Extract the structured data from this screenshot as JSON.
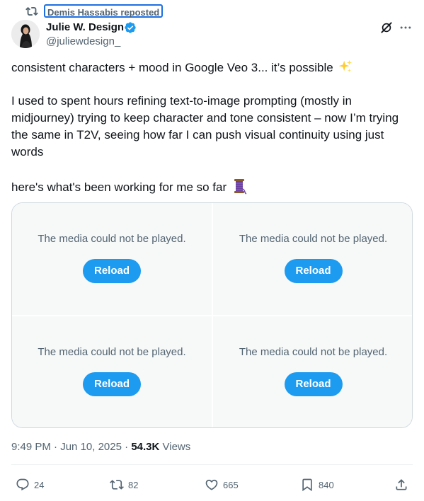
{
  "repost": {
    "label": "Demis Hassabis reposted",
    "icon": "repost-icon"
  },
  "author": {
    "name": "Julie W. Design",
    "handle": "@juliewdesign_",
    "verified": true
  },
  "post": {
    "line1": "consistent characters + mood in Google Veo 3... it’s possible",
    "line2": "I used to spent hours refining text-to-image prompting (mostly in midjourney) trying to keep character and tone consistent – now I’m trying the same in T2V, seeing how far I can push visual continuity using just words",
    "line3": "here's what's been working for me so far"
  },
  "media": [
    {
      "message": "The media could not be played.",
      "button": "Reload"
    },
    {
      "message": "The media could not be played.",
      "button": "Reload"
    },
    {
      "message": "The media could not be played.",
      "button": "Reload"
    },
    {
      "message": "The media could not be played.",
      "button": "Reload"
    }
  ],
  "meta": {
    "time": "9:49 PM",
    "date": "Jun 10, 2025",
    "views_count": "54.3K",
    "views_label": "Views"
  },
  "actions": {
    "replies": "24",
    "reposts": "82",
    "likes": "665",
    "bookmarks": "840"
  },
  "colors": {
    "accent": "#1d9bf0",
    "secondary_text": "#536471",
    "border": "#cfd9de"
  }
}
